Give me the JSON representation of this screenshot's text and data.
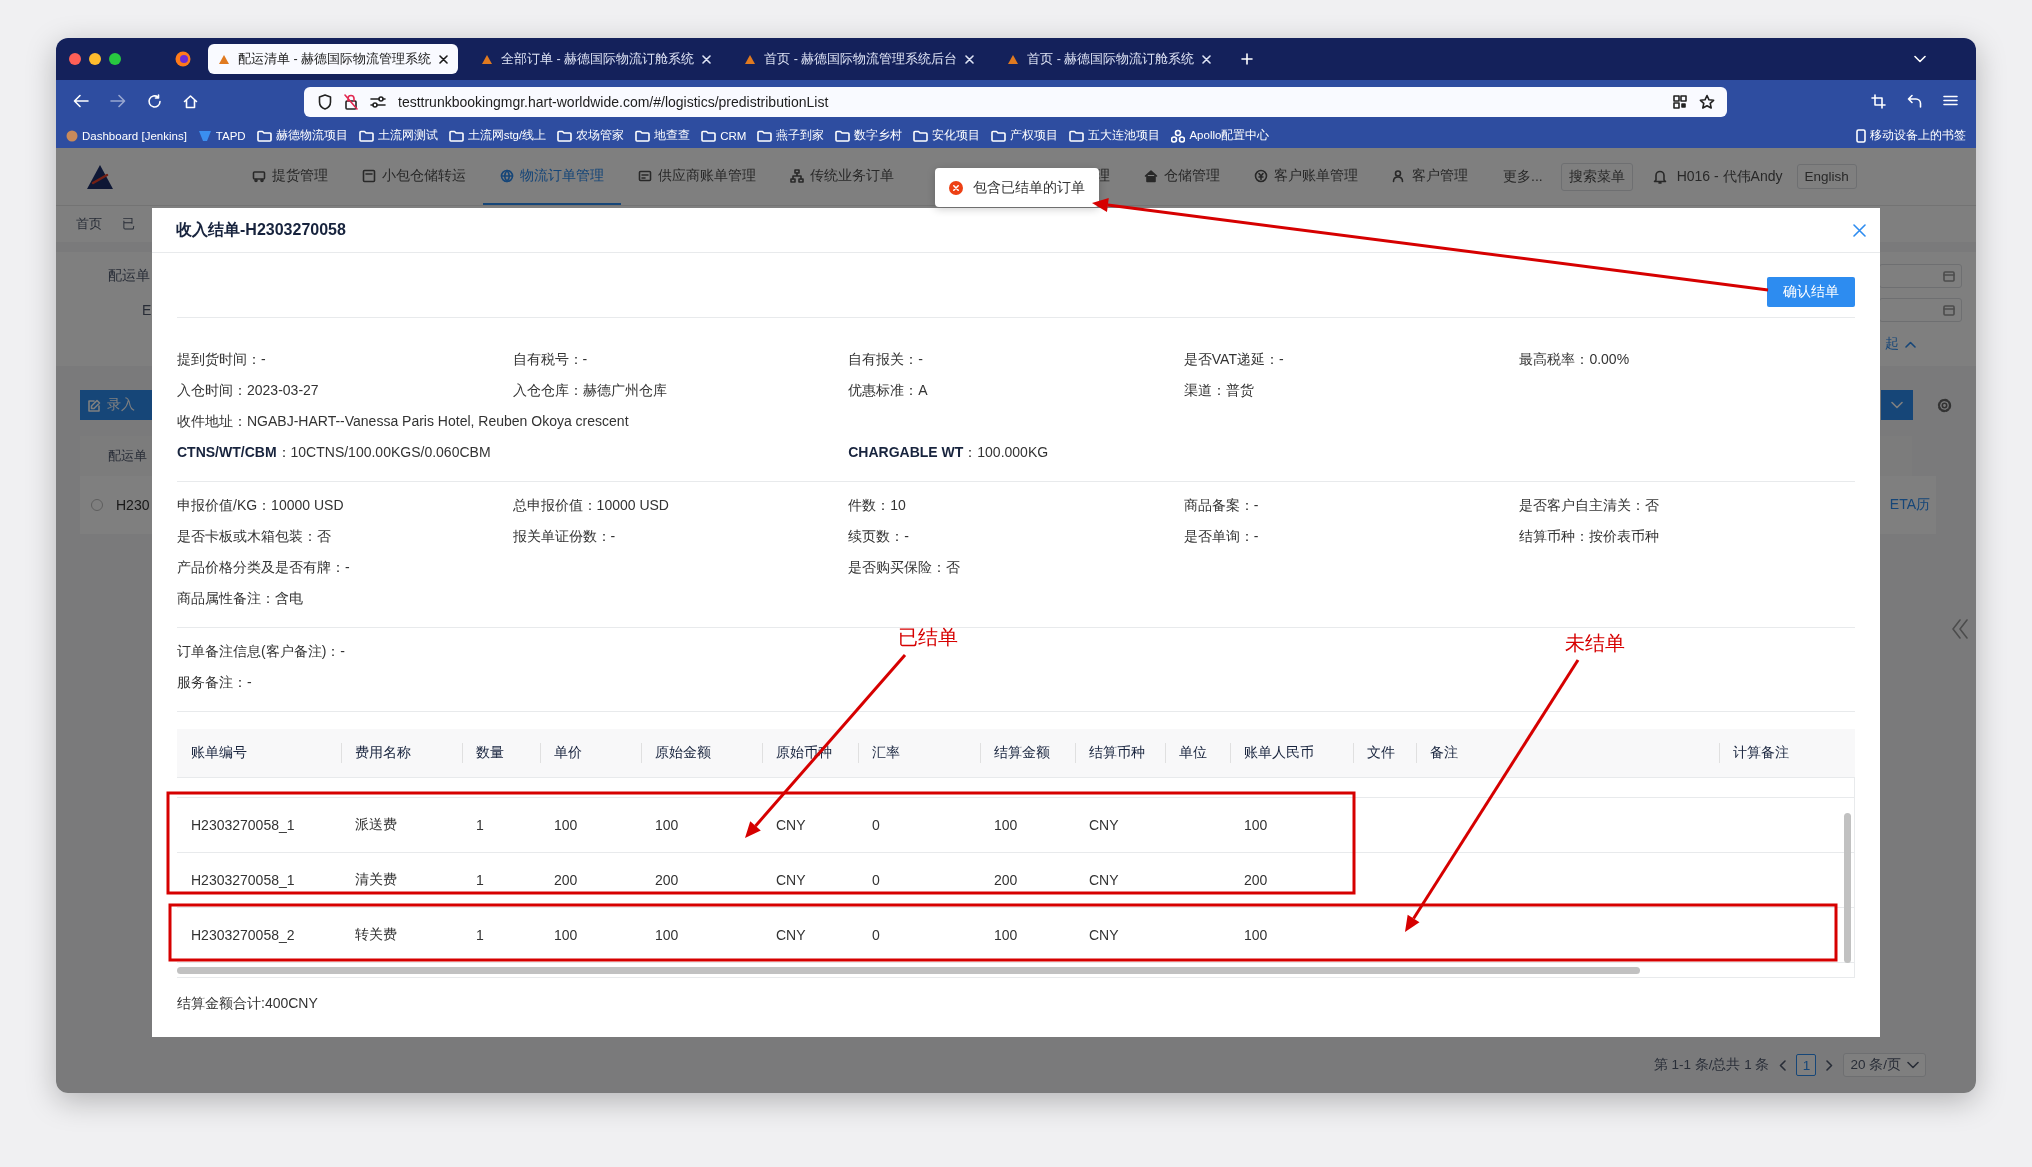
{
  "browser": {
    "tabs": [
      {
        "title": "配运清单 - 赫德国际物流管理系统",
        "selected": true
      },
      {
        "title": "全部订单 - 赫德国际物流订舱系统",
        "selected": false
      },
      {
        "title": "首页 - 赫德国际物流管理系统后台",
        "selected": false
      },
      {
        "title": "首页 - 赫德国际物流订舱系统",
        "selected": false
      }
    ],
    "url": "testtrunkbookingmgr.hart-worldwide.com/#/logistics/predistributionList",
    "bookmarks": [
      {
        "label": "Dashboard [Jenkins]",
        "kind": "avatar"
      },
      {
        "label": "TAPD",
        "kind": "app"
      },
      {
        "label": "赫德物流项目",
        "kind": "folder"
      },
      {
        "label": "土流网测试",
        "kind": "folder"
      },
      {
        "label": "土流网stg/线上",
        "kind": "folder"
      },
      {
        "label": "农场管家",
        "kind": "folder"
      },
      {
        "label": "地查查",
        "kind": "folder"
      },
      {
        "label": "CRM",
        "kind": "folder"
      },
      {
        "label": "燕子到家",
        "kind": "folder"
      },
      {
        "label": "数字乡村",
        "kind": "folder"
      },
      {
        "label": "安化项目",
        "kind": "folder"
      },
      {
        "label": "产权项目",
        "kind": "folder"
      },
      {
        "label": "五大连池项目",
        "kind": "folder"
      },
      {
        "label": "Apollo配置中心",
        "kind": "service"
      }
    ],
    "mobile_bookmarks": "移动设备上的书签"
  },
  "app": {
    "nav": [
      {
        "label": "提货管理",
        "selected": false
      },
      {
        "label": "小包仓储转运",
        "selected": false
      },
      {
        "label": "物流订单管理",
        "selected": true
      },
      {
        "label": "供应商账单管理",
        "selected": false
      },
      {
        "label": "传统业务订单",
        "selected": false
      },
      {
        "label": "理",
        "selected": false
      },
      {
        "label": "仓储管理",
        "selected": false
      },
      {
        "label": "客户账单管理",
        "selected": false
      },
      {
        "label": "客户管理",
        "selected": false
      }
    ],
    "more": "更多...",
    "search_menu": "搜索菜单",
    "user": "H016 - 代伟Andy",
    "language": "English"
  },
  "page": {
    "breadcrumbs": [
      "首页",
      "已"
    ],
    "filters": [
      "配运单",
      "E"
    ],
    "collapse_link": "起",
    "add_button": "录入",
    "table_header": "配运单",
    "row_id": "H230",
    "row_selected": false,
    "row_link": "ETA历",
    "pagination": {
      "summary": "第 1-1 条/总共 1 条",
      "current": "1",
      "page_size": "20 条/页"
    }
  },
  "toast": {
    "kind": "error",
    "message": "包含已结单的订单"
  },
  "modal": {
    "title": "收入结单-H2303270058",
    "confirm_button": "确认结单",
    "sections": [
      [
        [
          "提到货时间：-",
          "自有税号：-",
          "自有报关：-",
          "是否VAT递延：-",
          "最高税率：0.00%"
        ],
        [
          "入仓时间：2023-03-27",
          "入仓仓库：赫德广州仓库",
          "优惠标准：A",
          "渠道：普货"
        ],
        [
          "收件地址：NGABJ-HART--Vanessa Paris Hotel, Reuben Okoya crescent"
        ],
        [
          "**CTNS/WT/CBM**：10CTNS/100.00KGS/0.060CBM",
          "**CHARGABLE WT**：100.000KG"
        ]
      ],
      [
        [
          "申报价值/KG：10000 USD",
          "总申报价值：10000 USD",
          "件数：10",
          "商品备案：-",
          "是否客户自主清关：否"
        ],
        [
          "是否卡板或木箱包装：否",
          "报关单证份数：-",
          "续页数：-",
          "是否单询：-",
          "结算币种：按价表币种"
        ],
        [
          "产品价格分类及是否有牌：-",
          "是否购买保险：否"
        ],
        [
          "商品属性备注：含电"
        ]
      ],
      [
        [
          "订单备注信息(客户备注)：-"
        ],
        [
          "服务备注：-"
        ]
      ]
    ],
    "table": {
      "columns": [
        "账单编号",
        "费用名称",
        "数量",
        "单价",
        "原始金额",
        "原始币种",
        "汇率",
        "结算金额",
        "结算币种",
        "单位",
        "账单人民币",
        "文件",
        "备注",
        "计算备注"
      ],
      "rows": [
        [
          "H2303270058_1",
          "派送费",
          "1",
          "100",
          "100",
          "CNY",
          "0",
          "100",
          "CNY",
          "",
          "100"
        ],
        [
          "H2303270058_1",
          "清关费",
          "1",
          "200",
          "200",
          "CNY",
          "0",
          "200",
          "CNY",
          "",
          "200"
        ],
        [
          "H2303270058_2",
          "转关费",
          "1",
          "100",
          "100",
          "CNY",
          "0",
          "100",
          "CNY",
          "",
          "100"
        ]
      ]
    },
    "total": "结算金额合计:400CNY"
  },
  "annotations": [
    {
      "kind": "label",
      "text": "已结单"
    },
    {
      "kind": "label",
      "text": "未结单"
    }
  ]
}
